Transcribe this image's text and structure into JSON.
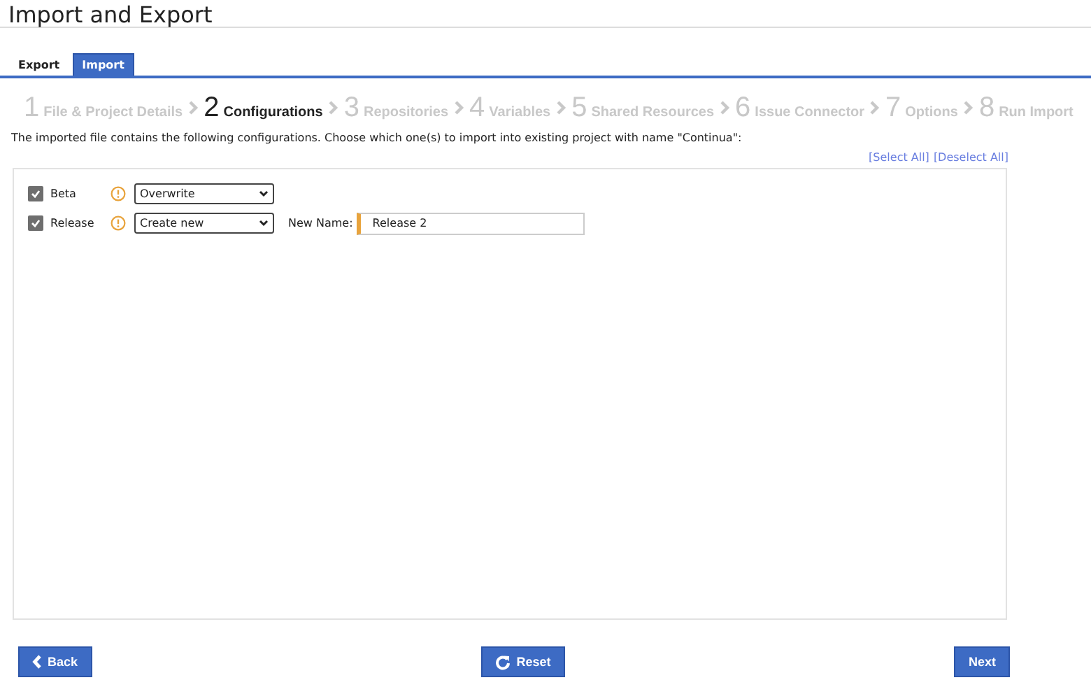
{
  "title": "Import and Export",
  "tabs": [
    {
      "label": "Export",
      "selected": false
    },
    {
      "label": "Import",
      "selected": true
    }
  ],
  "steps": [
    {
      "number": "1",
      "label": "File & Project Details",
      "selected": false
    },
    {
      "number": "2",
      "label": "Configurations",
      "selected": true
    },
    {
      "number": "3",
      "label": "Repositories",
      "selected": false
    },
    {
      "number": "4",
      "label": "Variables",
      "selected": false
    },
    {
      "number": "5",
      "label": "Shared Resources",
      "selected": false
    },
    {
      "number": "6",
      "label": "Issue Connector",
      "selected": false
    },
    {
      "number": "7",
      "label": "Options",
      "selected": false
    },
    {
      "number": "8",
      "label": "Run Import",
      "selected": false
    }
  ],
  "description": "The imported file contains the following configurations. Choose which one(s) to import into existing project with name \"Continua\":",
  "links": [
    "[Select All]",
    "[Deselect All]"
  ],
  "configurations": [
    {
      "label": "Beta",
      "checked": true,
      "action": "Overwrite"
    },
    {
      "label": "Release",
      "checked": true,
      "action": "Create new",
      "new_name_label": "New Name:",
      "new_name": "Release 2"
    }
  ],
  "buttons": [
    {
      "kind": "back",
      "label": "Back"
    },
    {
      "kind": "reset",
      "label": "Reset"
    },
    {
      "kind": "next",
      "label": "Next"
    }
  ]
}
